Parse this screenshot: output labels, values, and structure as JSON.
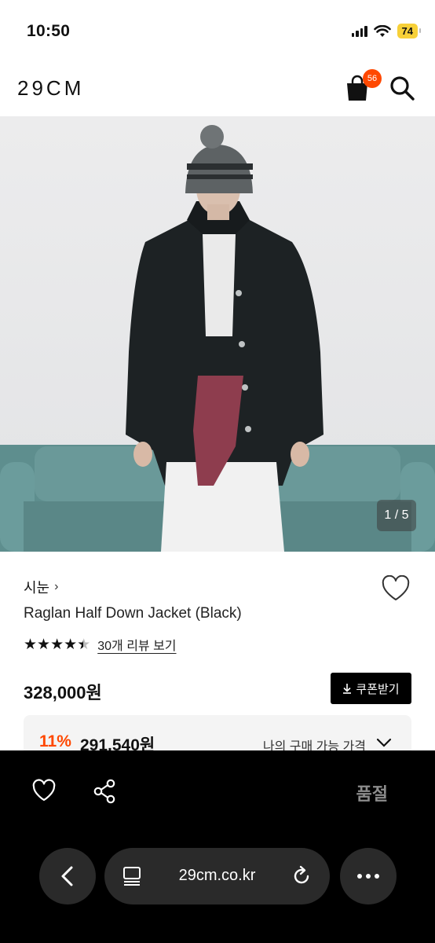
{
  "status_bar": {
    "time": "10:50",
    "battery": "74"
  },
  "header": {
    "logo": "29CM",
    "cart_count": "56"
  },
  "gallery": {
    "counter": "1 / 5"
  },
  "product": {
    "brand": "시눈",
    "brand_chevron": "›",
    "name": "Raglan Half Down Jacket (Black)",
    "rating_stars": 4.5,
    "review_link": "30개 리뷰 보기",
    "price": "328,000원",
    "coupon_button": "쿠폰받기",
    "discount_percent": "11%",
    "discount_price": "291,540원",
    "discount_label": "나의 구매 가능 가격"
  },
  "bottom_bar": {
    "sold_out": "품절"
  },
  "browser": {
    "url": "29cm.co.kr"
  },
  "colors": {
    "accent": "#ff4800",
    "battery": "#f7d038"
  },
  "icons": [
    "cart-icon",
    "search-icon",
    "heart-icon",
    "share-icon",
    "chevron-down-icon",
    "download-icon",
    "back-icon",
    "tabs-icon",
    "reload-icon",
    "more-icon"
  ]
}
